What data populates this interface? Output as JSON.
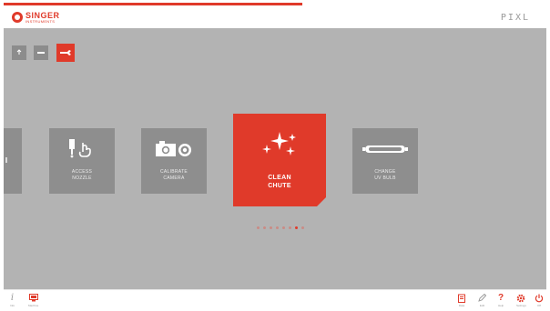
{
  "header": {
    "logo_brand": "SINGER",
    "logo_sub": "INSTRUMENTS",
    "product": "PIXL"
  },
  "mode_buttons": [
    {
      "icon": "upload-icon"
    },
    {
      "icon": "minus-icon"
    },
    {
      "icon": "wrench-icon",
      "active": true
    }
  ],
  "carousel": {
    "cards": [
      {
        "label_line1": "ACCESS",
        "label_line2": "NOZZLE",
        "icon": "nozzle-hand-icon"
      },
      {
        "label_line1": "CALIBRATE",
        "label_line2": "CAMERA",
        "icon": "camera-icon"
      },
      {
        "label_line1": "CLEAN",
        "label_line2": "CHUTE",
        "icon": "sparkle-icon",
        "selected": true
      },
      {
        "label_line1": "CHANGE",
        "label_line2": "UV BULB",
        "icon": "uv-bulb-icon"
      }
    ],
    "page_count": 8,
    "active_page": 6
  },
  "footer": {
    "left": [
      {
        "icon": "info-icon",
        "label": "Info"
      },
      {
        "icon": "monitor-icon",
        "label": "Machine"
      }
    ],
    "right": [
      {
        "icon": "clipboard-icon",
        "label": "Data"
      },
      {
        "icon": "pencil-icon",
        "label": "Edit"
      },
      {
        "icon": "help-icon",
        "label": "Help"
      },
      {
        "icon": "settings-icon",
        "label": "Settings"
      },
      {
        "icon": "power-icon",
        "label": "Off"
      }
    ]
  },
  "colors": {
    "accent": "#e03a2a",
    "background": "#b3b3b3",
    "card": "#8e8e8e"
  }
}
